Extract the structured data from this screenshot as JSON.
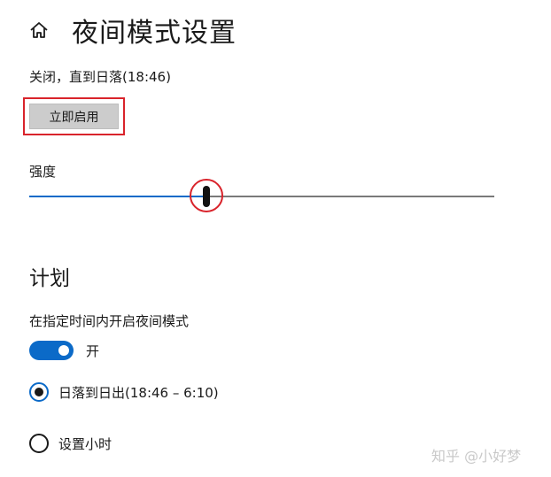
{
  "header": {
    "home_icon": "home-icon",
    "title": "夜间模式设置"
  },
  "status_text": "关闭，直到日落(18:46)",
  "enable_button": {
    "label": "立即启用",
    "highlight_color": "#d9232b"
  },
  "strength": {
    "label": "强度",
    "value_percent": 38
  },
  "schedule": {
    "section_title": "计划",
    "toggle_label": "在指定时间内开启夜间模式",
    "toggle_state": "开",
    "options": [
      {
        "label": "日落到日出(18:46 – 6:10)",
        "selected": true
      },
      {
        "label": "设置小时",
        "selected": false
      }
    ]
  },
  "watermark": "知乎 @小好梦",
  "colors": {
    "accent": "#0b6ac8",
    "annotation_red": "#d9232b"
  }
}
